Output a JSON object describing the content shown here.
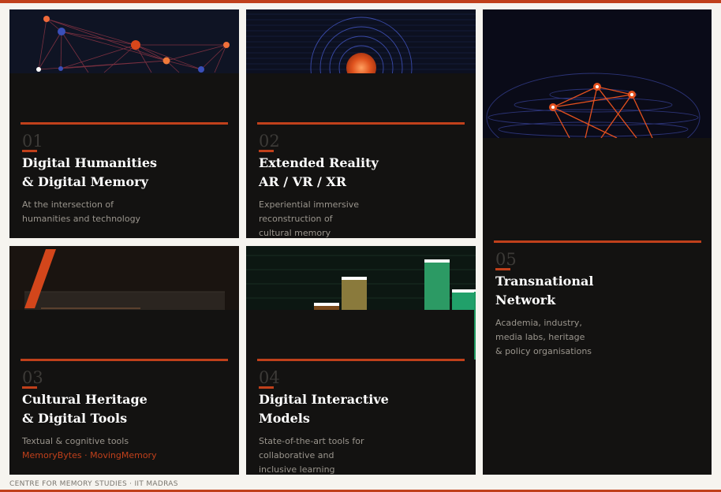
{
  "footer": "CENTRE FOR MEMORY STUDIES · IIT MADRAS",
  "colors": {
    "accent": "#c0401b",
    "card": "#131211",
    "page": "#f6f4ef",
    "green": "#2ea56b"
  },
  "cards": [
    {
      "number": "01",
      "title_line1": "Digital Humanities",
      "title_line2": "& Digital Memory",
      "desc_line1": "At the intersection of",
      "desc_line2": "humanities and technology",
      "art": "network-graph"
    },
    {
      "number": "02",
      "title_line1": "Extended Reality",
      "title_line2": "AR / VR / XR",
      "desc_line1": "Experiential immersive",
      "desc_line2": "reconstruction of",
      "desc_line3": "cultural memory",
      "art": "rising-sun-rings"
    },
    {
      "number": "03",
      "title_line1": "Cultural Heritage",
      "title_line2": "& Digital Tools",
      "desc_line1": "Textual & cognitive tools",
      "desc_link1": "MemoryBytes",
      "desc_sep": " · ",
      "desc_link2": "MovingMemory",
      "art": "slanted-bar"
    },
    {
      "number": "04",
      "title_line1": "Digital Interactive",
      "title_line2": "Models",
      "desc_line1": "State-of-the-art tools for",
      "desc_line2": "collaborative and",
      "desc_line3": "inclusive learning",
      "art": "bar-columns"
    },
    {
      "number": "05",
      "title_line1": "Transnational",
      "title_line2": "Network",
      "desc_line1": "Academia, industry,",
      "desc_line2": "media labs, heritage",
      "desc_line3": "& policy organisations",
      "art": "globe-network"
    }
  ]
}
